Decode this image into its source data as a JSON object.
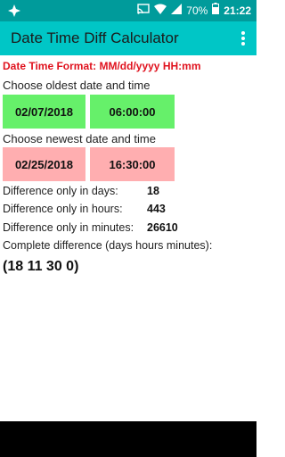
{
  "status_bar": {
    "battery_percent": "70%",
    "time": "21:22",
    "icons": [
      "app-notification-icon",
      "cast-icon",
      "wifi-icon",
      "signal-icon",
      "battery-icon"
    ]
  },
  "app_bar": {
    "title": "Date Time Diff Calculator",
    "menu_icon": "overflow-menu-icon"
  },
  "format_hint": "Date Time Format: MM/dd/yyyy HH:mm",
  "oldest": {
    "label": "Choose oldest date and time",
    "date": "02/07/2018",
    "time": "06:00:00"
  },
  "newest": {
    "label": "Choose newest date and time",
    "date": "02/25/2018",
    "time": "16:30:00"
  },
  "results": {
    "days_label": "Difference only in days:",
    "days_value": "18",
    "hours_label": "Difference only in hours:",
    "hours_value": "443",
    "minutes_label": "Difference only in minutes:",
    "minutes_value": "26610",
    "complete_label": "Complete difference (days hours minutes):",
    "complete_value": "(18 11 30 0)"
  },
  "colors": {
    "status_bar": "#009b9b",
    "app_bar": "#00c6c6",
    "oldest_buttons": "#66f06a",
    "newest_buttons": "#ffaeb0",
    "format_text": "#e0131f"
  }
}
